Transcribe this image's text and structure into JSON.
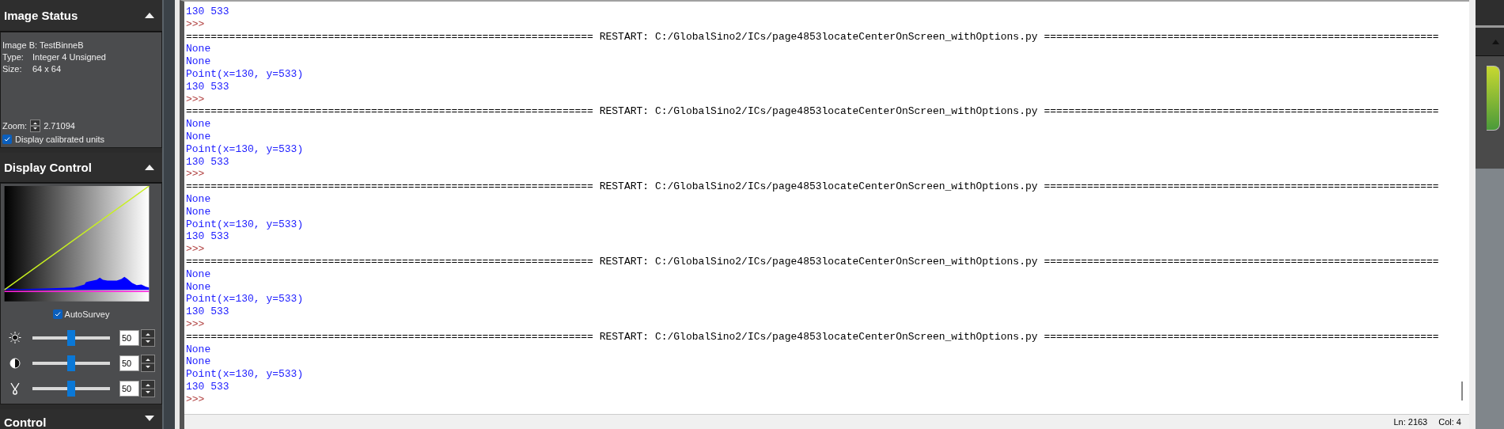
{
  "image_status": {
    "title": "Image Status",
    "expanded": true,
    "image": "Image B: TestBinneB",
    "rows": [
      {
        "label": "Type:",
        "value": "Integer 4 Unsigned"
      },
      {
        "label": "Size:",
        "value": "64 x 64"
      }
    ],
    "zoom_label": "Zoom:",
    "zoom_value": "2.71094",
    "calibrated": {
      "label": "Display calibrated units",
      "checked": true
    }
  },
  "display_control": {
    "title": "Display Control",
    "expanded": true,
    "auto_survey": {
      "label": "AutoSurvey",
      "checked": true
    },
    "sliders": [
      {
        "kind": "brightness",
        "level": 0.5,
        "value": "50"
      },
      {
        "kind": "contrast",
        "level": 0.5,
        "value": "50"
      },
      {
        "kind": "gamma",
        "level": 0.5,
        "value": "50"
      }
    ]
  },
  "control": {
    "title": "Control",
    "expanded": false
  },
  "console": {
    "lines": [
      {
        "kind": "output",
        "text": "130 533"
      },
      {
        "kind": "prompt",
        "text": ">>>"
      },
      {
        "kind": "restart",
        "text": "================================================================== RESTART: C:/GlobalSino2/ICs/page4853locateCenterOnScreen_withOptions.py ================================================================"
      },
      {
        "kind": "output",
        "text": "None"
      },
      {
        "kind": "output",
        "text": "None"
      },
      {
        "kind": "output",
        "text": "Point(x=130, y=533)"
      },
      {
        "kind": "output",
        "text": "130 533"
      },
      {
        "kind": "prompt",
        "text": ">>>"
      },
      {
        "kind": "restart",
        "text": "================================================================== RESTART: C:/GlobalSino2/ICs/page4853locateCenterOnScreen_withOptions.py ================================================================"
      },
      {
        "kind": "output",
        "text": "None"
      },
      {
        "kind": "output",
        "text": "None"
      },
      {
        "kind": "output",
        "text": "Point(x=130, y=533)"
      },
      {
        "kind": "output",
        "text": "130 533"
      },
      {
        "kind": "prompt",
        "text": ">>>"
      },
      {
        "kind": "restart",
        "text": "================================================================== RESTART: C:/GlobalSino2/ICs/page4853locateCenterOnScreen_withOptions.py ================================================================"
      },
      {
        "kind": "output",
        "text": "None"
      },
      {
        "kind": "output",
        "text": "None"
      },
      {
        "kind": "output",
        "text": "Point(x=130, y=533)"
      },
      {
        "kind": "output",
        "text": "130 533"
      },
      {
        "kind": "prompt",
        "text": ">>>"
      },
      {
        "kind": "restart",
        "text": "================================================================== RESTART: C:/GlobalSino2/ICs/page4853locateCenterOnScreen_withOptions.py ================================================================"
      },
      {
        "kind": "output",
        "text": "None"
      },
      {
        "kind": "output",
        "text": "None"
      },
      {
        "kind": "output",
        "text": "Point(x=130, y=533)"
      },
      {
        "kind": "output",
        "text": "130 533"
      },
      {
        "kind": "prompt",
        "text": ">>>"
      },
      {
        "kind": "restart",
        "text": "================================================================== RESTART: C:/GlobalSino2/ICs/page4853locateCenterOnScreen_withOptions.py ================================================================"
      },
      {
        "kind": "output",
        "text": "None"
      },
      {
        "kind": "output",
        "text": "None"
      },
      {
        "kind": "output",
        "text": "Point(x=130, y=533)"
      },
      {
        "kind": "output",
        "text": "130 533"
      },
      {
        "kind": "prompt",
        "text": ">>>"
      }
    ]
  },
  "status_bar": {
    "line": "Ln: 2163",
    "col": "Col: 4"
  }
}
